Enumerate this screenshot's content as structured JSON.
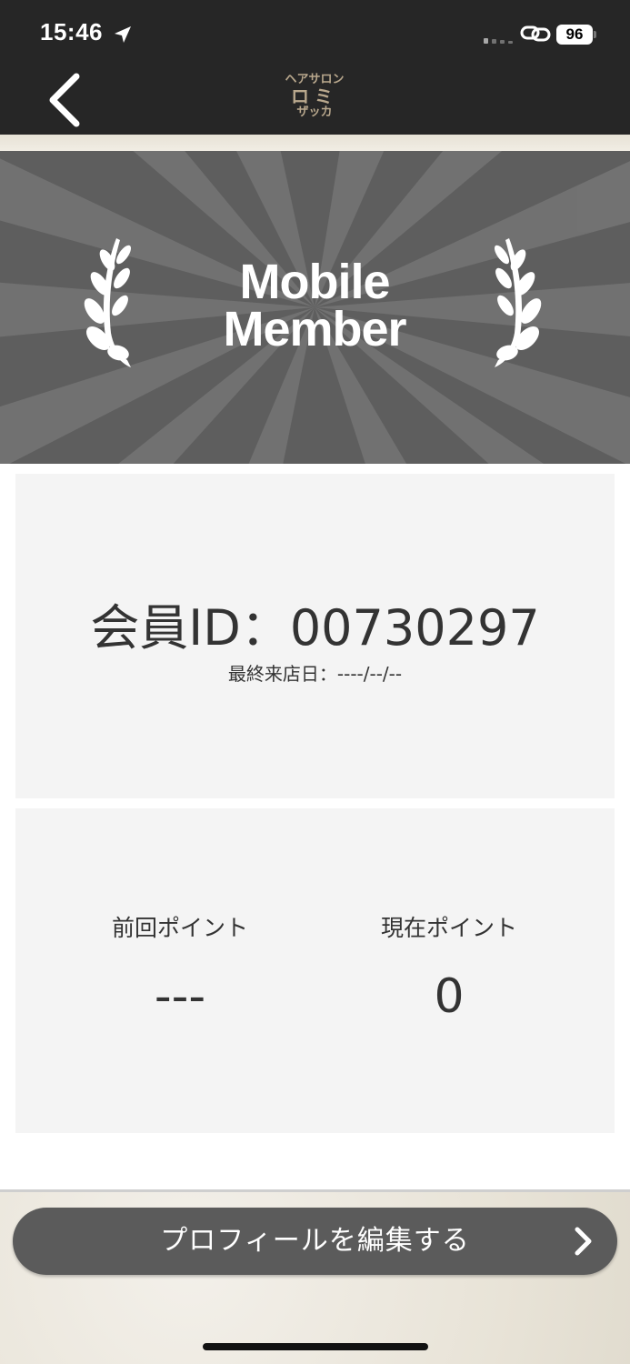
{
  "status_bar": {
    "time": "15:46",
    "battery": "96"
  },
  "nav": {
    "logo": {
      "line1": "ヘアサロン",
      "line2": "ロミ",
      "line3": "ザッカ"
    }
  },
  "banner": {
    "line1": "Mobile",
    "line2": "Member"
  },
  "member": {
    "id_text": "会員ID：00730297",
    "last_visit_text": "最終来店日：----/--/--"
  },
  "points": {
    "previous_label": "前回ポイント",
    "previous_value": "---",
    "current_label": "現在ポイント",
    "current_value": "0"
  },
  "actions": {
    "edit_profile_label": "プロフィールを編集する"
  },
  "colors": {
    "topbar": "#262626",
    "banner": "#5e5e5e",
    "card": "#f4f4f4",
    "button": "#5b5b5b",
    "logo": "#b9a88d"
  }
}
